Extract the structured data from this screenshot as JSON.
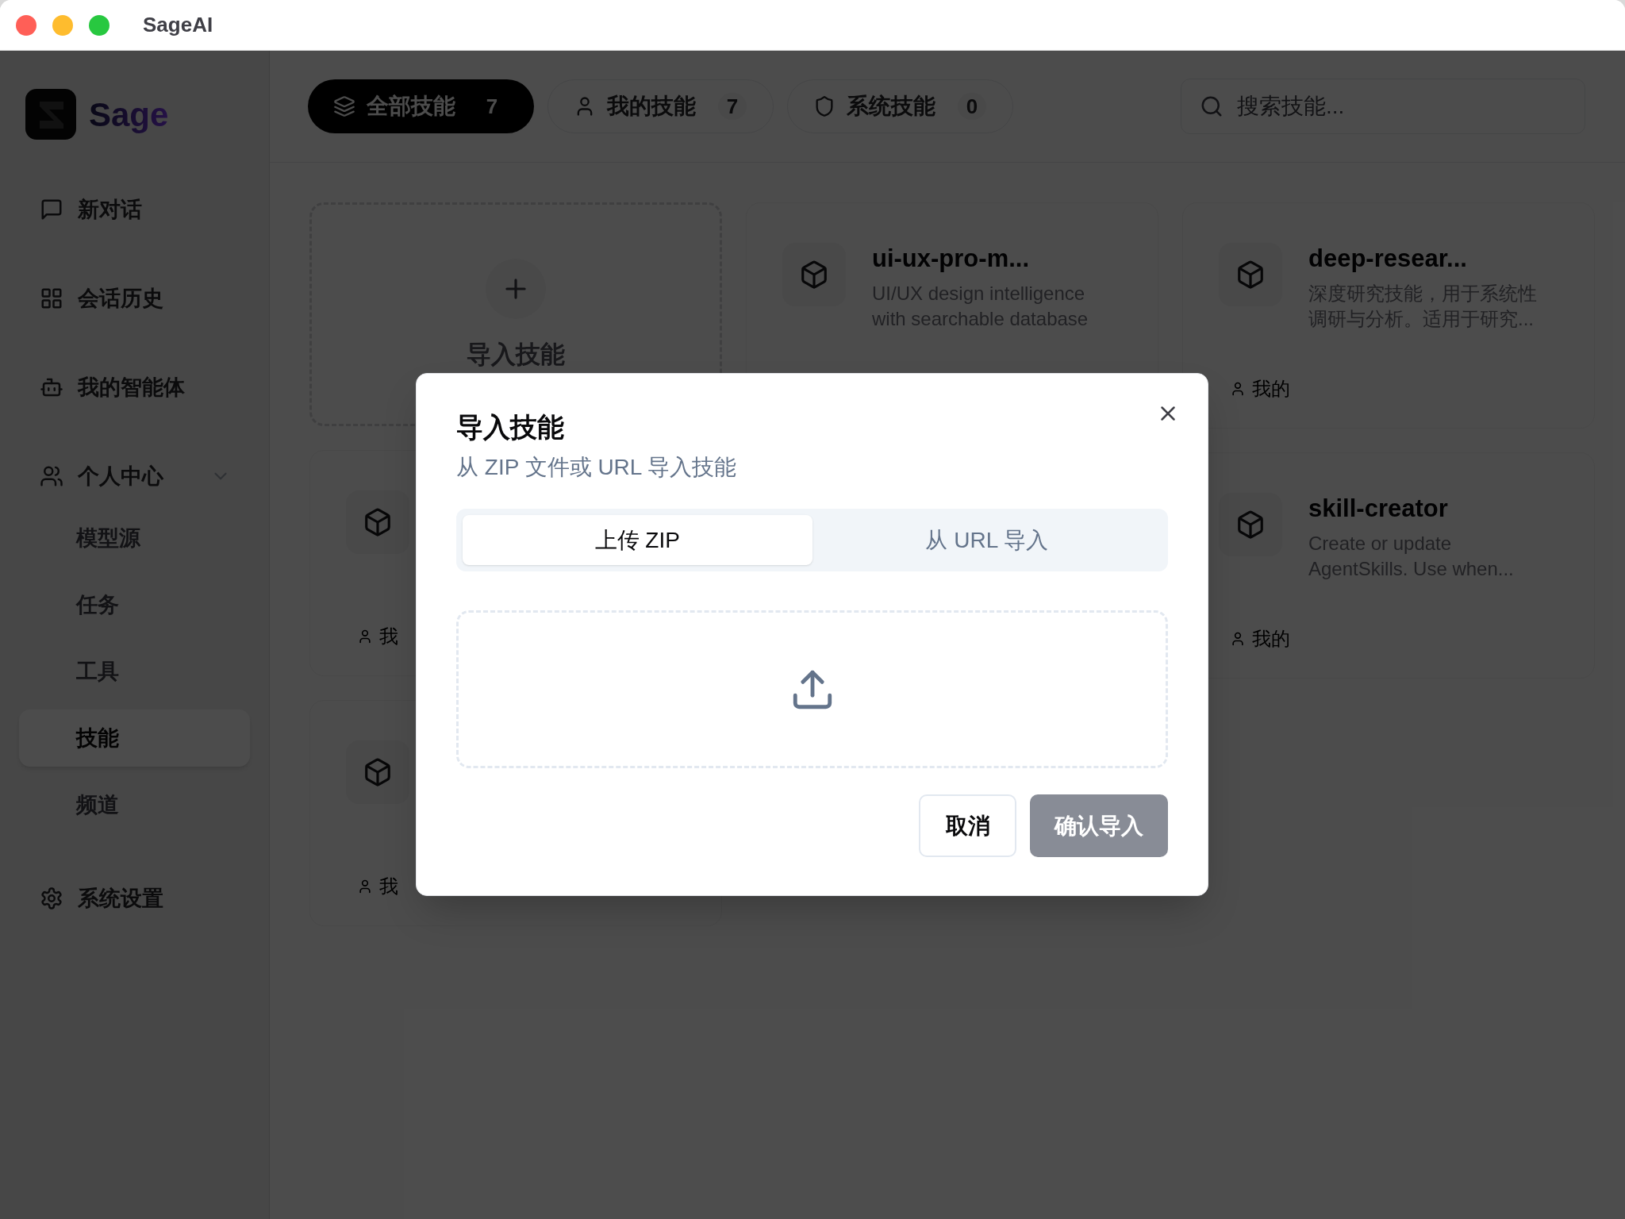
{
  "window": {
    "title": "SageAI"
  },
  "sidebar": {
    "brand": "Sage",
    "items": [
      {
        "kind": "chat",
        "label": "新对话",
        "selected": false
      },
      {
        "kind": "history",
        "label": "会话历史",
        "selected": false
      },
      {
        "kind": "agent",
        "label": "我的智能体",
        "selected": false
      },
      {
        "kind": "group",
        "label": "个人中心",
        "expanded": true,
        "children": [
          {
            "label": "模型源",
            "selected": false
          },
          {
            "label": "任务",
            "selected": false
          },
          {
            "label": "工具",
            "selected": false
          },
          {
            "label": "技能",
            "selected": true
          },
          {
            "label": "频道",
            "selected": false
          }
        ]
      },
      {
        "kind": "settings",
        "label": "系统设置",
        "selected": false
      }
    ]
  },
  "filter_tabs": [
    {
      "kind": "all",
      "label": "全部技能",
      "count": "7",
      "selected": true
    },
    {
      "kind": "mine",
      "label": "我的技能",
      "count": "7",
      "selected": false
    },
    {
      "kind": "system",
      "label": "系统技能",
      "count": "0",
      "selected": false
    }
  ],
  "search": {
    "placeholder": "搜索技能..."
  },
  "skill_grid": {
    "columns": [
      [
        {
          "kind": "import",
          "label": "导入技能"
        },
        {
          "kind": "skill",
          "tag": "我"
        },
        {
          "kind": "skill",
          "tag": "我"
        }
      ],
      [
        {
          "kind": "skill",
          "title": "ui-ux-pro-m...",
          "description": "UI/UX design intelligence with searchable database"
        }
      ],
      [
        {
          "kind": "skill",
          "title": "deep-resear...",
          "description": "深度研究技能，用于系统性调研与分析。适用于研究...",
          "tag": "我的"
        },
        {
          "kind": "skill",
          "title": "skill-creator",
          "description": "Create or update AgentSkills. Use when...",
          "tag": "我的"
        }
      ]
    ]
  },
  "dialog": {
    "title": "导入技能",
    "subtitle": "从 ZIP 文件或 URL 导入技能",
    "tabs": [
      {
        "label": "上传 ZIP",
        "selected": true
      },
      {
        "label": "从 URL 导入",
        "selected": false
      }
    ],
    "buttons": [
      {
        "kind": "cancel",
        "label": "取消",
        "disabled": false
      },
      {
        "kind": "confirm",
        "label": "确认导入",
        "disabled": true
      }
    ]
  }
}
